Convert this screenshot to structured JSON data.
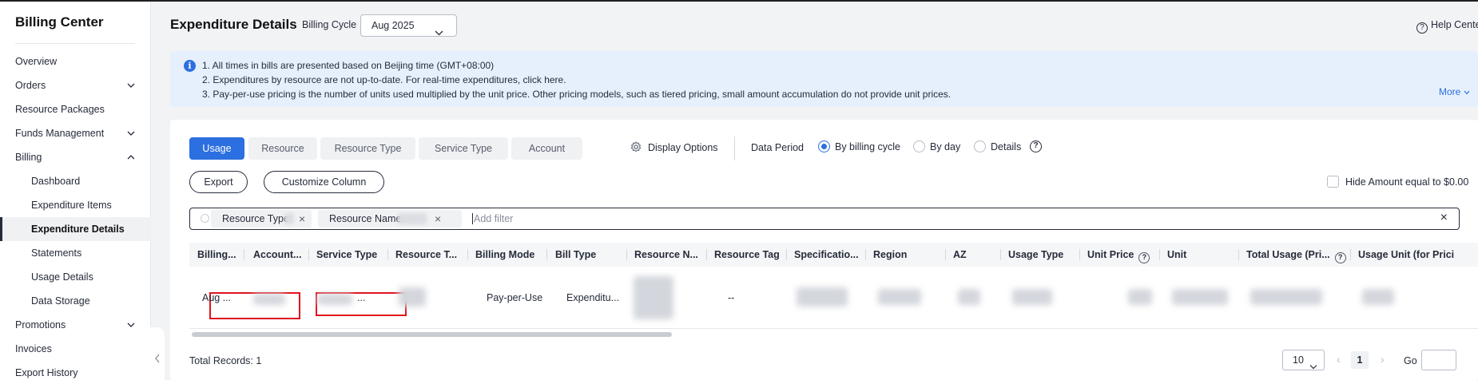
{
  "sidebar": {
    "title": "Billing Center",
    "items": [
      {
        "label": "Overview"
      },
      {
        "label": "Orders"
      },
      {
        "label": "Resource Packages"
      },
      {
        "label": "Funds Management"
      },
      {
        "label": "Billing"
      },
      {
        "label": "Dashboard"
      },
      {
        "label": "Expenditure Items"
      },
      {
        "label": "Expenditure Details"
      },
      {
        "label": "Statements"
      },
      {
        "label": "Usage Details"
      },
      {
        "label": "Data Storage"
      },
      {
        "label": "Promotions"
      },
      {
        "label": "Invoices"
      },
      {
        "label": "Export History"
      }
    ],
    "active_item": "Expenditure Details"
  },
  "header": {
    "title": "Expenditure Details",
    "billing_cycle_label": "Billing Cycle",
    "billing_cycle_value": "Aug 2025",
    "help_label": "Help Center"
  },
  "notice": {
    "lines": [
      "1. All times in bills are presented based on Beijing time (GMT+08:00)",
      "2. Expenditures by resource are not up-to-date. For real-time expenditures, click here.",
      "3. Pay-per-use pricing is the number of units used multiplied by the unit price. Other pricing models, such as tiered pricing, small amount accumulation do not provide unit prices."
    ],
    "more_label": "More"
  },
  "tabs": [
    {
      "label": "Usage"
    },
    {
      "label": "Resource"
    },
    {
      "label": "Resource Type"
    },
    {
      "label": "Service Type"
    },
    {
      "label": "Account"
    }
  ],
  "active_tab": "Usage",
  "display_options_label": "Display Options",
  "data_period": {
    "label": "Data Period",
    "options": [
      {
        "label": "By billing cycle"
      },
      {
        "label": "By day"
      },
      {
        "label": "Details"
      }
    ],
    "selected": "By billing cycle"
  },
  "actions": {
    "export_label": "Export",
    "customize_label": "Customize Column",
    "hide_amount_label": "Hide Amount equal to $0.00"
  },
  "filter": {
    "chips": [
      {
        "label": "Resource Type:"
      },
      {
        "label": "Resource Name:"
      }
    ],
    "placeholder": "Add filter"
  },
  "table": {
    "columns": [
      {
        "label": "Billing..."
      },
      {
        "label": "Account..."
      },
      {
        "label": "Service Type"
      },
      {
        "label": "Resource T..."
      },
      {
        "label": "Billing Mode"
      },
      {
        "label": "Bill Type"
      },
      {
        "label": "Resource N..."
      },
      {
        "label": "Resource Tag"
      },
      {
        "label": "Specificatio..."
      },
      {
        "label": "Region"
      },
      {
        "label": "AZ"
      },
      {
        "label": "Usage Type"
      },
      {
        "label": "Unit Price"
      },
      {
        "label": "Unit"
      },
      {
        "label": "Total Usage (Pri..."
      },
      {
        "label": "Usage Unit (for Prici"
      }
    ],
    "rows": [
      {
        "billing_cycle": "Aug ...",
        "service_type": "...",
        "billing_mode": "Pay-per-Use",
        "bill_type": "Expenditu...",
        "resource_tag": "--"
      }
    ]
  },
  "footer": {
    "total_label": "Total Records: 1",
    "page_size": "10",
    "current_page": "1",
    "go_label": "Go"
  },
  "colors": {
    "accent": "#2b6fe0",
    "highlight_box": "#e0141e",
    "notice_bg": "#e6f0fc"
  }
}
